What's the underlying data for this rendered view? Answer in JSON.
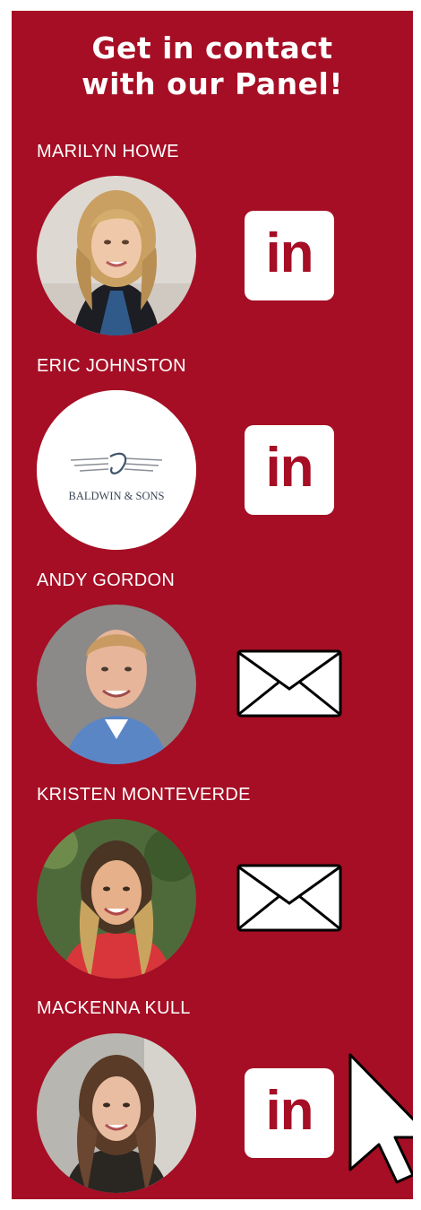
{
  "title": {
    "line1": "Get in contact",
    "line2": "with our Panel!"
  },
  "panel_color": "#a50e24",
  "members": [
    {
      "name": "MARILYN HOWE",
      "contact": "linkedin-icon",
      "contact_label": "in"
    },
    {
      "name": "ERIC JOHNSTON",
      "contact": "linkedin-icon",
      "contact_label": "in",
      "logo_text": "BALDWIN & SONS"
    },
    {
      "name": "ANDY GORDON",
      "contact": "envelope-icon"
    },
    {
      "name": "KRISTEN MONTEVERDE",
      "contact": "envelope-icon"
    },
    {
      "name": "MACKENNA KULL",
      "contact": "linkedin-icon",
      "contact_label": "in"
    }
  ]
}
